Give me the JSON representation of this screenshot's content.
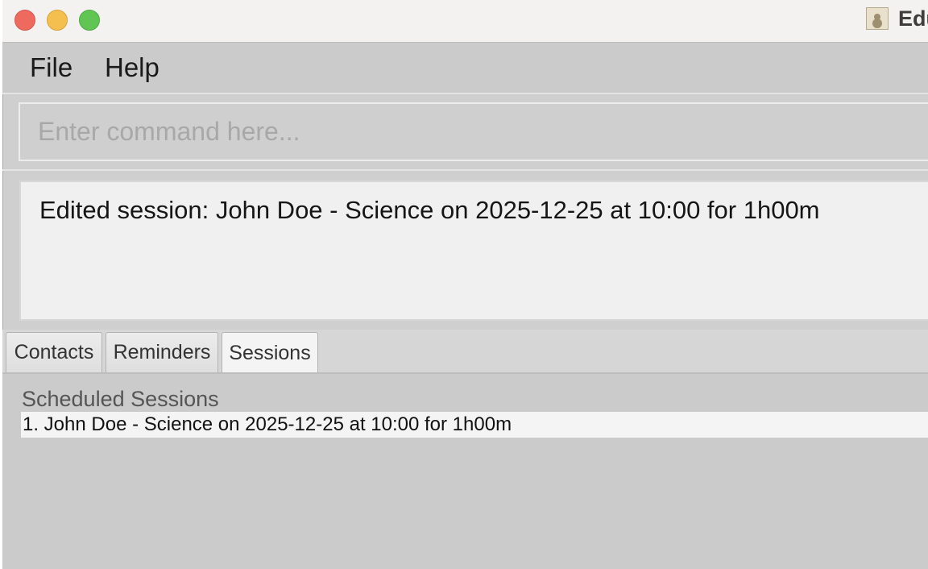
{
  "window": {
    "title": "Edu"
  },
  "menu": {
    "file_label": "File",
    "help_label": "Help"
  },
  "command": {
    "placeholder": "Enter command here..."
  },
  "result": {
    "message": "Edited session: John Doe - Science on 2025-12-25 at 10:00 for 1h00m"
  },
  "tabs": [
    {
      "label": "Contacts",
      "selected": false
    },
    {
      "label": "Reminders",
      "selected": false
    },
    {
      "label": "Sessions",
      "selected": true
    }
  ],
  "sessions": {
    "heading": "Scheduled Sessions",
    "items": [
      {
        "text": "1. John Doe - Science on 2025-12-25 at 10:00 for 1h00m"
      }
    ]
  },
  "colors": {
    "close": "#ee6a5f",
    "minimize": "#f5bf4f",
    "maximize": "#61c554"
  },
  "icons": {
    "app": "address-book-icon"
  }
}
